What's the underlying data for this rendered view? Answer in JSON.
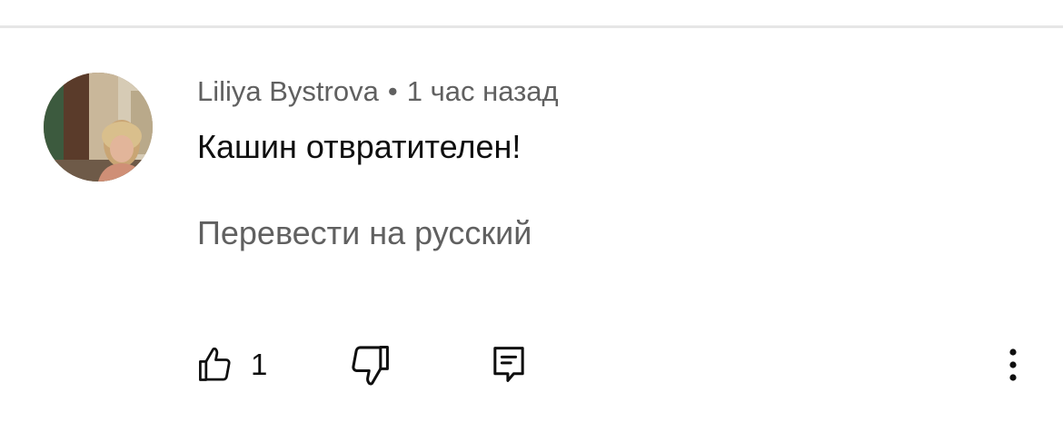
{
  "comment": {
    "author": "Liliya Bystrova",
    "separator": "•",
    "timestamp": "1 час назад",
    "text": "Кашин отвратителен!",
    "translate_label": "Перевести на русский",
    "avatar_icon": "user-photo-avatar"
  },
  "actions": {
    "like_icon": "thumb-up-icon",
    "like_count": "1",
    "dislike_icon": "thumb-down-icon",
    "reply_icon": "reply-comment-icon",
    "more_icon": "more-vertical-icon"
  },
  "colors": {
    "background": "#ffffff",
    "primary_text": "#0f0f0f",
    "secondary_text": "#606060",
    "divider": "#e6e6e6"
  }
}
